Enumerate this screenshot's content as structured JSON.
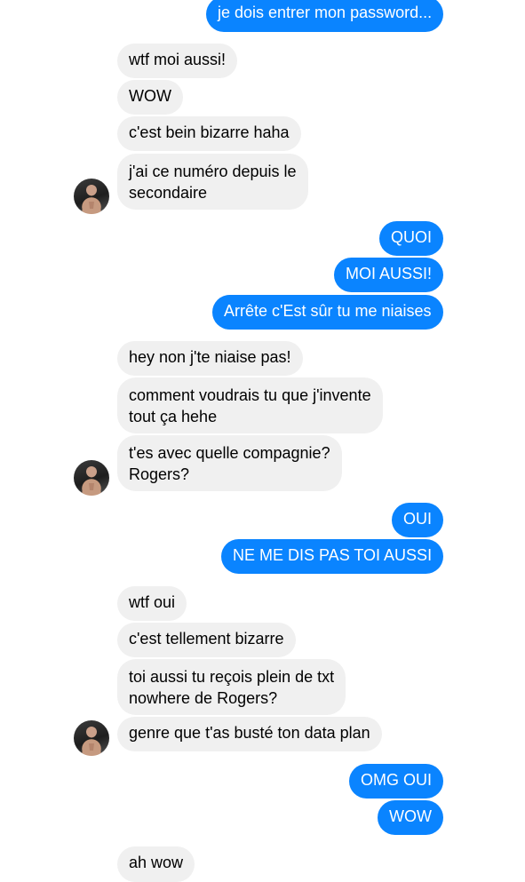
{
  "conversation": {
    "messages": [
      {
        "dir": "out",
        "text": "je dois entrer mon password..."
      },
      {
        "dir": "in",
        "text": "wtf moi aussi!"
      },
      {
        "dir": "in",
        "text": "WOW"
      },
      {
        "dir": "in",
        "text": "c'est bein bizarre haha"
      },
      {
        "dir": "in",
        "text": "j'ai ce numéro depuis le\nsecondaire",
        "avatar": true
      },
      {
        "dir": "out",
        "text": "QUOI"
      },
      {
        "dir": "out",
        "text": "MOI AUSSI!"
      },
      {
        "dir": "out",
        "text": "Arrête c'Est sûr tu me niaises"
      },
      {
        "dir": "in",
        "text": "hey non j'te niaise pas!"
      },
      {
        "dir": "in",
        "text": "comment voudrais tu que j'invente\ntout ça hehe"
      },
      {
        "dir": "in",
        "text": "t'es avec quelle compagnie?\nRogers?",
        "avatar": true
      },
      {
        "dir": "out",
        "text": "OUI"
      },
      {
        "dir": "out",
        "text": "NE ME DIS PAS TOI AUSSI"
      },
      {
        "dir": "in",
        "text": "wtf oui"
      },
      {
        "dir": "in",
        "text": "c'est tellement bizarre"
      },
      {
        "dir": "in",
        "text": "toi aussi tu reçois plein de txt\nnowhere de Rogers?"
      },
      {
        "dir": "in",
        "text": "genre que t'as busté ton data plan",
        "avatar": true
      },
      {
        "dir": "out",
        "text": "OMG OUI"
      },
      {
        "dir": "out",
        "text": "WOW"
      },
      {
        "dir": "in",
        "text": "ah wow"
      }
    ]
  },
  "colors": {
    "outgoing_bubble": "#0a84ff",
    "incoming_bubble": "#f0f0f0",
    "background": "#ffffff"
  },
  "icons": {
    "contact_avatar": "person-photo-icon"
  }
}
